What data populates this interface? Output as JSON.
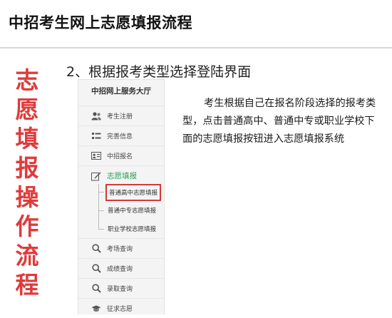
{
  "header": {
    "title": "中招考生网上志愿填报流程"
  },
  "side_title": [
    "志",
    "愿",
    "填",
    "报",
    "操",
    "作",
    "流",
    "程"
  ],
  "step_heading": "2、根据报考类型选择登陆界面",
  "panel": {
    "title": "中招网上服务大厅",
    "items": [
      {
        "label": "考生注册",
        "icon": "users-icon"
      },
      {
        "label": "完善信息",
        "icon": "list-icon"
      },
      {
        "label": "中招报名",
        "icon": "id-card-icon"
      },
      {
        "label": "志愿填报",
        "icon": "edit-icon"
      },
      {
        "label": "考场查询",
        "icon": "search-icon"
      },
      {
        "label": "成绩查询",
        "icon": "search-icon"
      },
      {
        "label": "录取查询",
        "icon": "search-icon"
      },
      {
        "label": "征求志愿",
        "icon": "graduation-cap-icon"
      }
    ],
    "sub_items": [
      {
        "label": "普通高中志愿填报",
        "highlighted": true
      },
      {
        "label": "普通中专志愿填报",
        "highlighted": false
      },
      {
        "label": "职业学校志愿填报",
        "highlighted": false
      }
    ]
  },
  "description": "考生根据自己在报名阶段选择的报考类型，点击普通高中、普通中专或职业学校下面的志愿填报按钮进入志愿填报系统",
  "colors": {
    "side_title": "#e03a3a",
    "active_menu": "#2e9b57",
    "highlight_border": "#d23a3a"
  }
}
